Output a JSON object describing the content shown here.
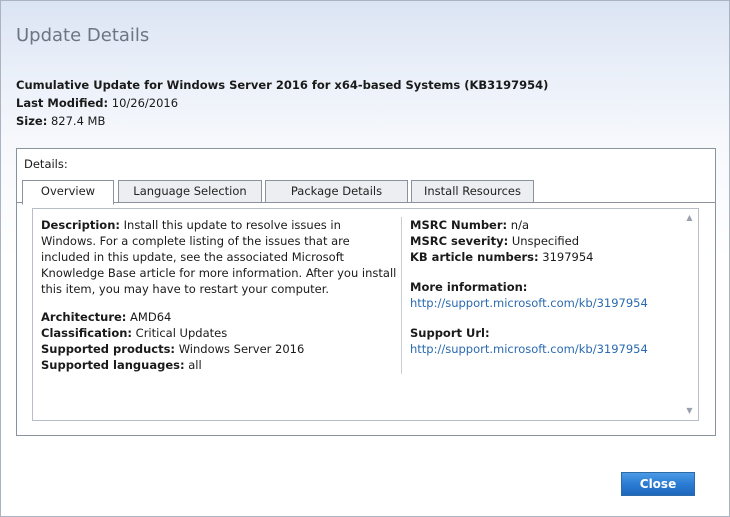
{
  "dialog": {
    "title": "Update Details"
  },
  "update": {
    "name": "Cumulative Update for Windows Server 2016 for x64-based Systems (KB3197954)",
    "last_modified_label": "Last Modified:",
    "last_modified": "10/26/2016",
    "size_label": "Size:",
    "size": "827.4 MB"
  },
  "details": {
    "label": "Details:",
    "tabs": [
      {
        "label": "Overview",
        "active": true
      },
      {
        "label": "Language Selection",
        "active": false
      },
      {
        "label": "Package Details",
        "active": false
      },
      {
        "label": "Install Resources",
        "active": false
      }
    ]
  },
  "overview": {
    "description_label": "Description:",
    "description": "Install this update to resolve issues in Windows. For a complete listing of the issues that are included in this update, see the associated Microsoft Knowledge Base article for more information. After you install this item, you may have to restart your computer.",
    "architecture_label": "Architecture:",
    "architecture": "AMD64",
    "classification_label": "Classification:",
    "classification": "Critical Updates",
    "products_label": "Supported products:",
    "products": "Windows Server 2016",
    "languages_label": "Supported languages:",
    "languages": "all",
    "msrc_number_label": "MSRC Number:",
    "msrc_number": "n/a",
    "msrc_severity_label": "MSRC severity:",
    "msrc_severity": "Unspecified",
    "kb_label": "KB article numbers:",
    "kb": "3197954",
    "more_info_label": "More information:",
    "more_info_url": "http://support.microsoft.com/kb/3197954",
    "support_url_label": "Support Url:",
    "support_url": "http://support.microsoft.com/kb/3197954"
  },
  "buttons": {
    "close": "Close"
  },
  "colors": {
    "link": "#2a6ab0",
    "button": "#2a7cd3"
  }
}
